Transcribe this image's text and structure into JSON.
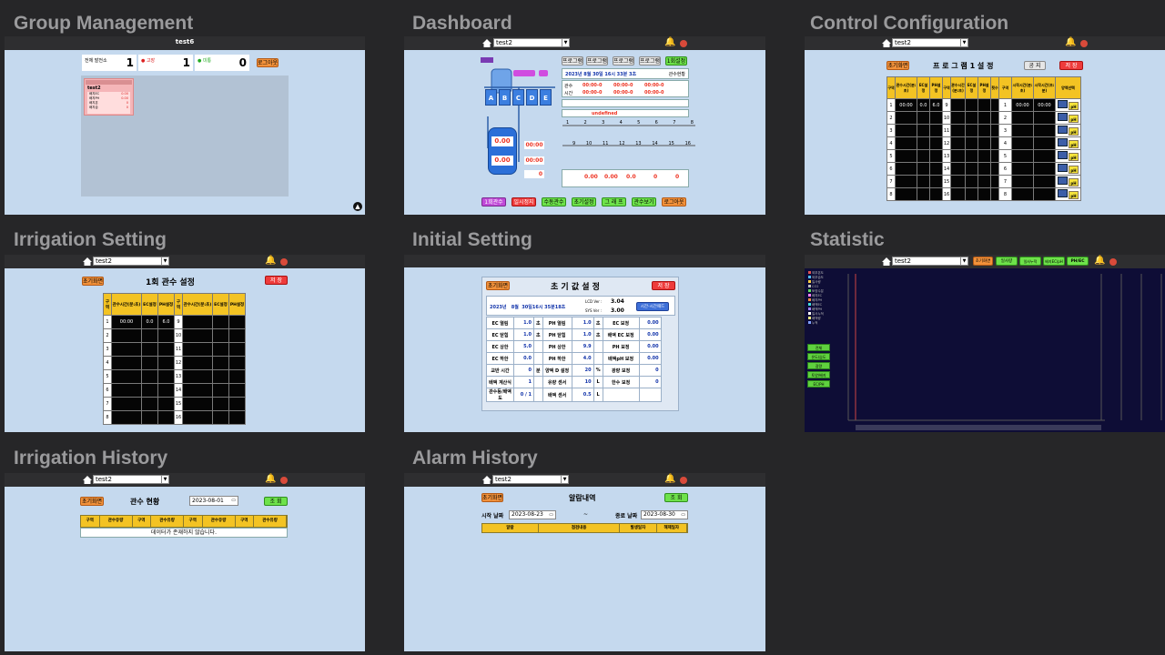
{
  "titles": {
    "group": "Group Management",
    "dashboard": "Dashboard",
    "control": "Control Configuration",
    "irrigation_setting": "Irrigation Setting",
    "initial": "Initial Setting",
    "statistic": "Statistic",
    "irrigation_history": "Irrigation History",
    "alarm_history": "Alarm History"
  },
  "group": {
    "topbar_title": "test6",
    "stats": [
      {
        "label": "전체 발전소",
        "value": "1"
      },
      {
        "label": "● 고장",
        "value": "1"
      },
      {
        "label": "● 미통",
        "value": "0"
      }
    ],
    "logout": "로그아웃",
    "card": {
      "header": "",
      "name": "test2",
      "rows": [
        {
          "k": "배지EC",
          "v": "0.00"
        },
        {
          "k": "배지PH",
          "v": "0.00"
        },
        {
          "k": "배지온",
          "v": "0"
        },
        {
          "k": "배지습",
          "v": "0"
        }
      ]
    }
  },
  "site_select": "test2",
  "dashboard": {
    "program_buttons": [
      "프로그램1",
      "프로그램2",
      "프로그램3",
      "프로그램4"
    ],
    "once": "1회설정",
    "date_text": "2023년 8월 30일 16시 33분 3초",
    "status_label": "관수현황",
    "tank_labels": [
      "A",
      "B",
      "C",
      "D",
      "E"
    ],
    "tank_ec": "0.00",
    "tank_ph": "0.00",
    "timers": [
      "00:00",
      "00:00"
    ],
    "time_rows": [
      {
        "label": "관수",
        "vals": [
          "00:00-0",
          "00:00-0",
          "00:00-0"
        ]
      },
      {
        "label": "시간",
        "vals": [
          "00:00-0",
          "00:00-0",
          "00:00-0"
        ]
      }
    ],
    "undefined_text": "undefined",
    "valve_numbers_top": [
      "1",
      "2",
      "3",
      "4",
      "5",
      "6",
      "7",
      "8"
    ],
    "valve_numbers_bottom": [
      "9",
      "10",
      "11",
      "12",
      "13",
      "14",
      "15",
      "16"
    ],
    "sensor_values": [
      "0.00",
      "0.00",
      "0.0",
      "0",
      "0"
    ],
    "bottom_buttons": [
      "1회관수",
      "일시정지",
      "수동관수",
      "초기설정",
      "그 래 프",
      "관수보기",
      "로그아웃"
    ]
  },
  "control": {
    "init": "초기화면",
    "title": "프 로 그 램 1 설 정",
    "apply": "공 지",
    "save": "저 장",
    "headers_left": [
      "구역",
      "관수시간(분:초)",
      "EC설정",
      "PH설정",
      "구역"
    ],
    "headers_right": [
      "횟수",
      "시작시간(분:초)",
      "시작시간(초:분)",
      "양액선택"
    ],
    "row1": [
      "00:00",
      "0.0",
      "6.0"
    ],
    "row1_right": [
      "00:00",
      "00:00"
    ],
    "left_nums": [
      "1",
      "2",
      "3",
      "4",
      "5",
      "6",
      "7",
      "8"
    ],
    "mid_nums": [
      "9",
      "10",
      "11",
      "12",
      "13",
      "14",
      "15",
      "16"
    ],
    "right_nums": [
      "1",
      "2",
      "3",
      "4",
      "5",
      "6",
      "7",
      "8"
    ],
    "ph_label": "pH"
  },
  "irrigation": {
    "init": "초기화면",
    "title": "1회 관수 설정",
    "save": "저 장",
    "headers": [
      "구역",
      "관수시간(분:초)",
      "EC설정",
      "PH설정",
      "구역",
      "관수시간(분:초)",
      "EC설정",
      "PH설정"
    ],
    "row1": [
      "00:00",
      "0.0",
      "6.0"
    ],
    "left_nums": [
      "1",
      "2",
      "3",
      "4",
      "5",
      "6",
      "7",
      "8"
    ],
    "right_nums": [
      "9",
      "10",
      "11",
      "12",
      "13",
      "14",
      "15",
      "16"
    ]
  },
  "initial": {
    "init": "초기화면",
    "title": "초 기 값  설 정",
    "save": "저 장",
    "date": "2023년   8월  30일16시 35분18초",
    "lcd_label": "LCD Ver :",
    "lcd": "3.04",
    "sys_label": "SYS Ver :",
    "sys": "3.00",
    "time_sync": "시간-시간패드",
    "rows": [
      [
        "EC 열림",
        "1.0",
        "초",
        "PH 열림",
        "1.0",
        "초",
        "EC 보정",
        "0.00"
      ],
      [
        "EC 닫힘",
        "1.0",
        "초",
        "PH 닫힘",
        "1.0",
        "초",
        "배액 EC 보정",
        "0.00"
      ],
      [
        "EC 상한",
        "5.0",
        "",
        "PH 상한",
        "9.9",
        "",
        "PH 보정",
        "0.00"
      ],
      [
        "EC 하한",
        "0.0",
        "",
        "PH 하한",
        "4.0",
        "",
        "배액pH 보정",
        "0.00"
      ],
      [
        "교반 시간",
        "0",
        "분",
        "양액 D 설정",
        "20",
        "%",
        "광량 보정",
        "0"
      ],
      [
        "배액 계산식",
        "1",
        "",
        "유량 센서",
        "10",
        "L",
        "한수 보정",
        "0"
      ],
      [
        "관수등/배액도",
        "0  /  1",
        "",
        "배액 센서",
        "0.5",
        "L",
        "",
        ""
      ]
    ]
  },
  "statistic": {
    "tabs": [
      "초기화면",
      "일사량",
      "일사누적",
      "배지EC/pH",
      "PH/EC"
    ],
    "side_buttons": [
      "전체",
      "온도/습도",
      "광량",
      "토양/배지",
      "EC/PH"
    ],
    "legend": [
      "외부온도",
      "외부습도",
      "일사량",
      "CO2",
      "토양수분",
      "배지EC",
      "배지PH",
      "배액EC",
      "배액PH",
      "일사누적",
      "배액량",
      "누적"
    ]
  },
  "history": {
    "init": "초기화면",
    "title": "관수 현황",
    "date": "2023-08-01",
    "query": "조 회",
    "headers": [
      "구역",
      "관수유량",
      "구역",
      "관수유량",
      "구역",
      "관수유량",
      "구역",
      "관수유량"
    ],
    "empty": "데이터가 존재하지 않습니다."
  },
  "alarm": {
    "init": "초기화면",
    "title": "알람내역",
    "query": "조 회",
    "start_label": "시작 날짜",
    "start_date": "2023-08-23",
    "sep": "~",
    "end_label": "종료 날짜",
    "end_date": "2023-08-30",
    "headers": [
      "알람",
      "점검내용",
      "발생일자",
      "해제일자"
    ]
  }
}
